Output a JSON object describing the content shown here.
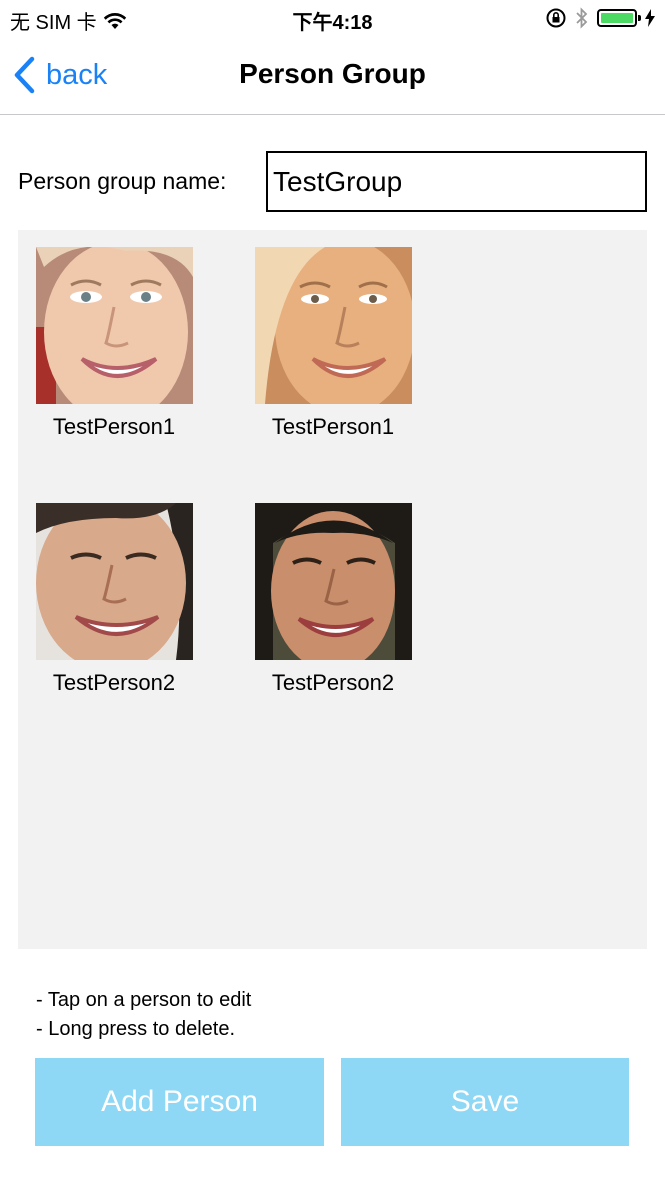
{
  "status_bar": {
    "carrier": "无 SIM 卡",
    "time": "下午4:18"
  },
  "nav": {
    "back_label": "back",
    "title": "Person Group"
  },
  "form": {
    "name_label": "Person group name:",
    "name_value": "TestGroup"
  },
  "persons": [
    {
      "name": "TestPerson1"
    },
    {
      "name": "TestPerson1"
    },
    {
      "name": "TestPerson2"
    },
    {
      "name": "TestPerson2"
    }
  ],
  "instructions": {
    "line1": "- Tap on a person to edit",
    "line2": "- Long press to delete."
  },
  "buttons": {
    "add_person": "Add Person",
    "save": "Save"
  },
  "colors": {
    "accent": "#1a82f7",
    "button_bg": "#8ed7f5",
    "grid_bg": "#f2f2f2",
    "battery": "#4cd964"
  }
}
